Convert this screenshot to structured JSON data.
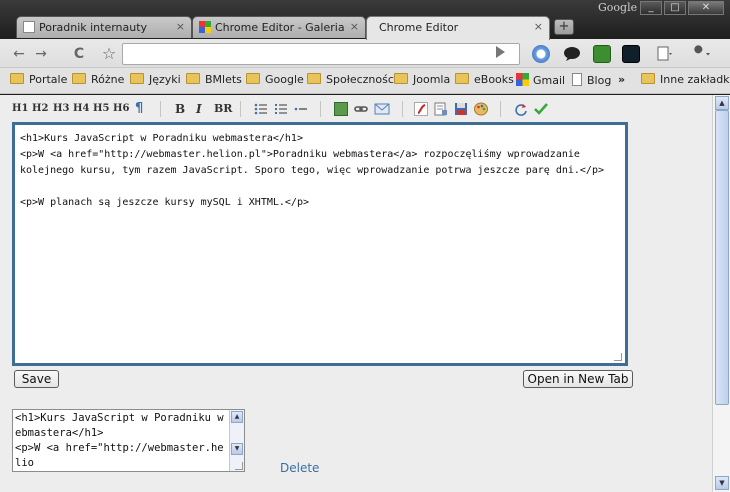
{
  "window": {
    "brand": "Google",
    "minimize": "_",
    "maximize": "□",
    "close": "✕"
  },
  "tabs": [
    {
      "label": "Poradnik internauty",
      "close": "×"
    },
    {
      "label": "Chrome Editor - Galeria roz…",
      "close": "×"
    },
    {
      "label": "Chrome Editor",
      "close": "×"
    }
  ],
  "new_tab": "+",
  "toolbar": {
    "back": "←",
    "forward": "→",
    "reload": "C",
    "star": "☆",
    "url": ""
  },
  "bookmarks": [
    {
      "label": "Portale",
      "icon": "folder-icon"
    },
    {
      "label": "Różne",
      "icon": "folder-icon"
    },
    {
      "label": "Języki",
      "icon": "folder-icon"
    },
    {
      "label": "BMlets",
      "icon": "folder-icon"
    },
    {
      "label": "Google",
      "icon": "folder-icon"
    },
    {
      "label": "Społeczności",
      "icon": "folder-icon"
    },
    {
      "label": "Joomla",
      "icon": "folder-icon"
    },
    {
      "label": "eBooks",
      "icon": "folder-icon"
    },
    {
      "label": "Gmail",
      "icon": "google-icon"
    },
    {
      "label": "Blog",
      "icon": "document-icon"
    }
  ],
  "bookmarks_more": "»",
  "bookmarks_other": "Inne zakładki",
  "format_bar": {
    "headings": [
      "H1",
      "H2",
      "H3",
      "H4",
      "H5",
      "H6"
    ],
    "paragraph": "¶",
    "bold": "B",
    "italic": "I",
    "br": "BR"
  },
  "editor": {
    "content": "<h1>Kurs JavaScript w Poradniku webmastera</h1>\n<p>W <a href=\"http://webmaster.helion.pl\">Poradniku webmastera</a> rozpoczęliśmy wprowadzanie kolejnego kursu, tym razem JavaScript. Sporo tego, więc wprowadzanie potrwa jeszcze parę dni.</p>\n\n<p>W planach są jeszcze kursy mySQL i XHTML.</p>"
  },
  "buttons": {
    "save": "Save",
    "open_new_tab": "Open in New Tab"
  },
  "saved_snippet": {
    "content": "<h1>Kurs JavaScript w Poradniku webmastera</h1>\n<p>W <a href=\"http://webmaster.helio",
    "delete": "Delete"
  },
  "colors": {
    "editor_border": "#3e6d96",
    "link": "#3a6fa5",
    "accent_green": "#3aa83a"
  }
}
